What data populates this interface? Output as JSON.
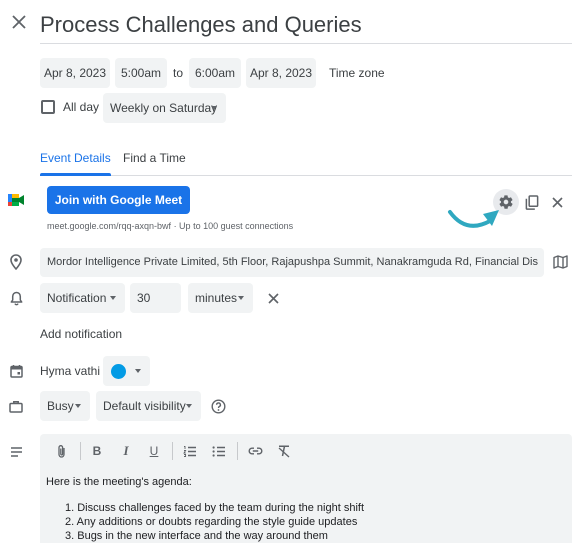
{
  "event": {
    "title": "Process Challenges and Queries",
    "start_date": "Apr 8, 2023",
    "start_time": "5:00am",
    "to_label": "to",
    "end_time": "6:00am",
    "end_date": "Apr 8, 2023",
    "timezone_label": "Time zone",
    "all_day_label": "All day",
    "recurrence": "Weekly on Saturday"
  },
  "tabs": [
    {
      "label": "Event Details",
      "active": true
    },
    {
      "label": "Find a Time",
      "active": false
    }
  ],
  "meet": {
    "button_label": "Join with Google Meet",
    "link_info": "meet.google.com/rqq-axqn-bwf · Up to 100 guest connections"
  },
  "location": "Mordor Intelligence Private Limited, 5th Floor, Rajapushpa Summit, Nanakramguda Rd, Financial Dis",
  "notification": {
    "type": "Notification",
    "value": "30",
    "unit": "minutes",
    "add_label": "Add notification"
  },
  "calendar": {
    "owner": "Hyma vathi",
    "color": "#039be5"
  },
  "availability": {
    "status": "Busy",
    "visibility": "Default visibility"
  },
  "description": {
    "intro": "Here is the meeting's agenda:",
    "items": [
      "Discuss challenges faced by the team during the night shift",
      "Any additions or doubts regarding the style guide updates",
      "Bugs in the new interface and the way around them"
    ]
  },
  "colors": {
    "accent": "#1a73e8",
    "annotation_arrow": "#2fa8c0",
    "toolbar_bg": "#f1f3f4"
  }
}
